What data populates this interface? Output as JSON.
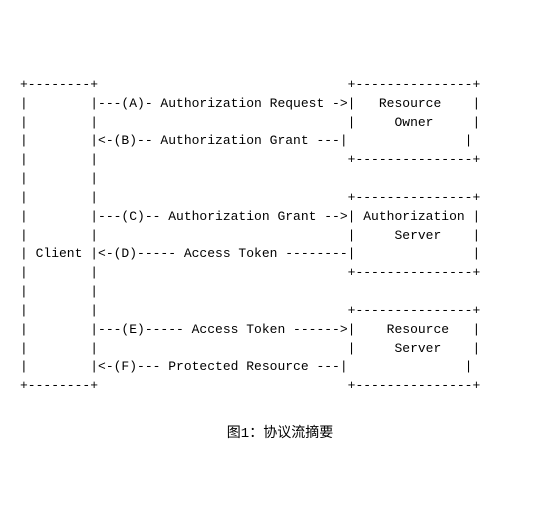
{
  "diagram": {
    "lines": [
      "+--------+                                  +---------------+",
      "|        |---(A)- Authorization Request ->|  Resource     |",
      "|        |                                  |  Owner        |",
      "|        |<-(B)-- Authorization Grant ---|  |               |",
      "|        |                                  +---------------+",
      "|        |                                                   ",
      "|        |                                  +---------------+",
      "|        |---(C)-- Authorization Grant ->|  Authorization |",
      "|        |                                  |  Server       |",
      "| Client |<-(D)----- Access Token --------|               |",
      "|        |                                  +---------------+",
      "|        |                                                   ",
      "|        |                                  +---------------+",
      "|        |---(E)----- Access Token ------->|  Resource     |",
      "|        |                                  |  Server       |",
      "|        |<-(F)--- Protected Resource ---|               |",
      "+--------+                                  +---------------+"
    ],
    "caption": "图1：协议流摘要"
  }
}
